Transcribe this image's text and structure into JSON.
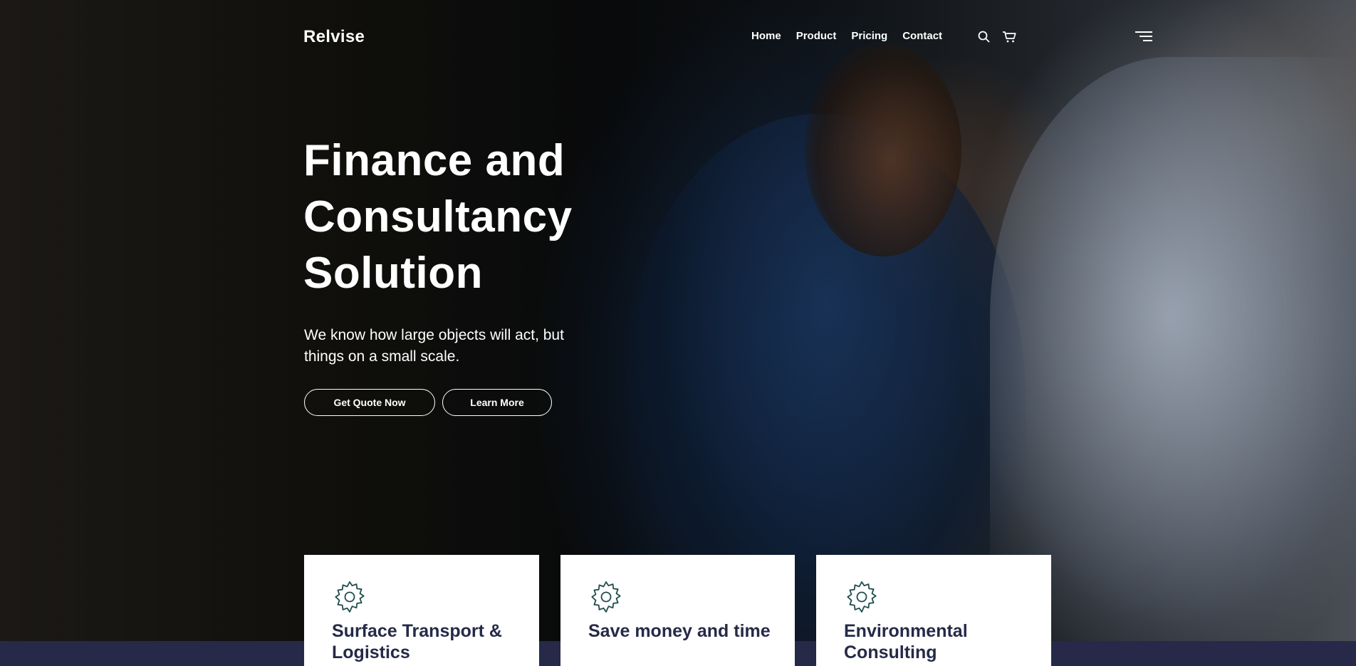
{
  "brand": {
    "name": "Relvise"
  },
  "nav": {
    "items": [
      "Home",
      "Product",
      "Pricing",
      "Contact"
    ]
  },
  "hero": {
    "title_lines": [
      "Finance and",
      "Consultancy",
      "Solution"
    ],
    "subtitle": "We know how large objects will act, but things on a small scale."
  },
  "buttons": {
    "quote": "Get Quote Now",
    "learn": "Learn More"
  },
  "cards": [
    {
      "title": "Surface Transport & Logistics",
      "icon": "gear-icon"
    },
    {
      "title": "Save money and time",
      "icon": "gear-icon"
    },
    {
      "title": "Environmental Consulting",
      "icon": "gear-icon"
    }
  ],
  "colors": {
    "navy": "#262a48",
    "white": "#ffffff",
    "icon_teal": "#1f4d4a"
  }
}
